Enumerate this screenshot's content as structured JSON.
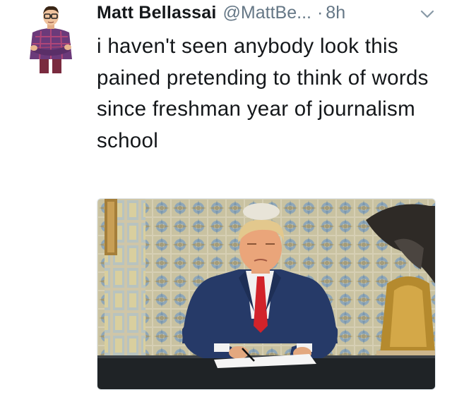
{
  "author": {
    "name": "Matt Bellassai",
    "handle": "@MattBe...",
    "separator": "·",
    "time": "8h"
  },
  "tweet": {
    "text": "i haven't seen anybody look this pained pretending to think of words since freshman year of journalism school"
  },
  "icons": {
    "menu": "chevron-down-icon"
  },
  "colors": {
    "text": "#14171a",
    "secondary": "#657786",
    "border": "#e1e8ed"
  }
}
